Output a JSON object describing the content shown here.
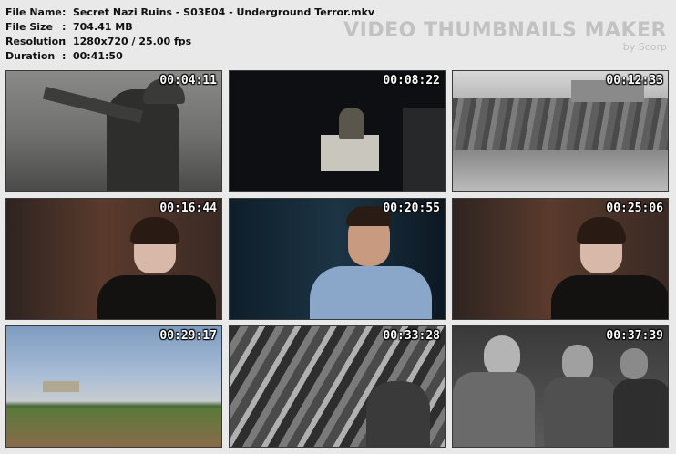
{
  "info": {
    "rows": [
      {
        "label": "File Name",
        "sep": ":",
        "value": "Secret Nazi Ruins - S03E04 - Underground Terror.mkv"
      },
      {
        "label": "File Size",
        "sep": ":",
        "value": "704.41 MB"
      },
      {
        "label": "Resolution",
        "sep": ":",
        "value": "1280x720 / 25.00 fps"
      },
      {
        "label": "Duration",
        "sep": ":",
        "value": "00:41:50"
      }
    ]
  },
  "brand": {
    "title": "VIDEO THUMBNAILS MAKER",
    "subtitle": "by Scorp"
  },
  "thumbnails": [
    {
      "timestamp": "00:04:11",
      "scene": "soldiers-pointing"
    },
    {
      "timestamp": "00:08:22",
      "scene": "dark-interior-officer"
    },
    {
      "timestamp": "00:12:33",
      "scene": "bombed-ruins"
    },
    {
      "timestamp": "00:16:44",
      "scene": "woman-interview-gesturing"
    },
    {
      "timestamp": "00:20:55",
      "scene": "man-interview"
    },
    {
      "timestamp": "00:25:06",
      "scene": "woman-interview"
    },
    {
      "timestamp": "00:29:17",
      "scene": "coastal-fortification"
    },
    {
      "timestamp": "00:33:28",
      "scene": "crowd-salute"
    },
    {
      "timestamp": "00:37:39",
      "scene": "officers-map-table"
    }
  ]
}
